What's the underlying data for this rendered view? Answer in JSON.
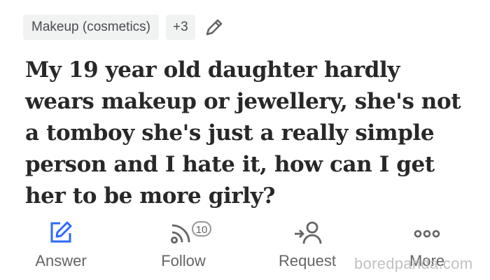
{
  "topics": {
    "primary": "Makeup (cosmetics)",
    "more_count": "+3"
  },
  "question": {
    "text": "My 19 year old daughter hardly wears makeup or jewellery, she's not a tomboy she's just a really simple person and I hate it, how can I get her to be more girly?"
  },
  "actions": {
    "answer": {
      "label": "Answer",
      "icon": "answer-pencil-icon"
    },
    "follow": {
      "label": "Follow",
      "icon": "follow-rss-icon",
      "count": "10"
    },
    "request": {
      "label": "Request",
      "icon": "request-person-icon"
    },
    "more": {
      "label": "More",
      "icon": "more-dots-icon"
    }
  },
  "watermark": "boredpanda.com",
  "colors": {
    "accent": "#2e69ff",
    "text": "#282829",
    "muted": "#636466",
    "chip_bg": "#f1f2f2"
  }
}
